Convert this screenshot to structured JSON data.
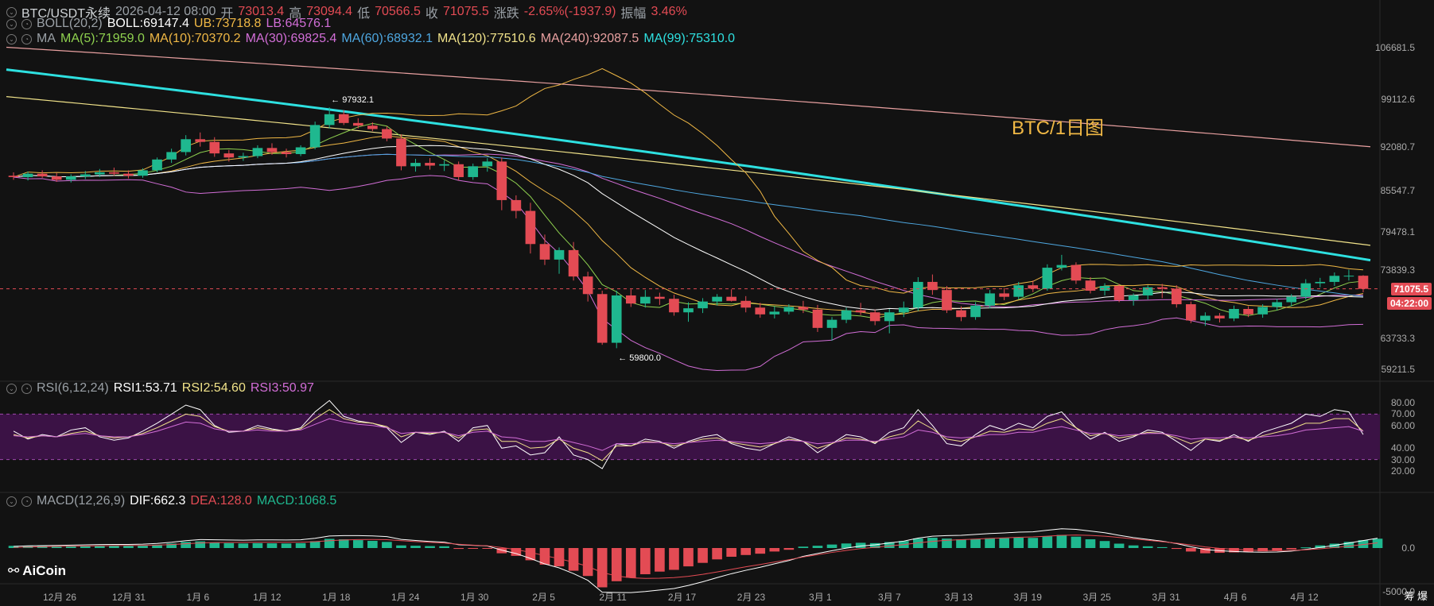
{
  "header": {
    "symbol": "BTC/USDT永续",
    "datetime": "2026-04-12 08:00",
    "open_label": "开",
    "open": "73013.4",
    "high_label": "高",
    "high": "73094.4",
    "low_label": "低",
    "low": "70566.5",
    "close_label": "收",
    "close": "71075.5",
    "change_label": "涨跌",
    "change": "-2.65%(-1937.9)",
    "amp_label": "振幅",
    "amp": "3.46%"
  },
  "boll": {
    "name": "BOLL(20,2)",
    "boll": "BOLL:69147.4",
    "ub": "UB:73718.8",
    "lb": "LB:64576.1"
  },
  "ma": {
    "name": "MA",
    "items": [
      {
        "text": "MA(5):71959.0",
        "color": "#8fd14f"
      },
      {
        "text": "MA(10):70370.2",
        "color": "#f0b845"
      },
      {
        "text": "MA(30):69825.4",
        "color": "#d26ed7"
      },
      {
        "text": "MA(60):68932.1",
        "color": "#4ea7e0"
      },
      {
        "text": "MA(120):77510.6",
        "color": "#f1e38a"
      },
      {
        "text": "MA(240):92087.5",
        "color": "#e8a0a0"
      },
      {
        "text": "MA(99):75310.0",
        "color": "#2ee0e0"
      }
    ]
  },
  "rsi": {
    "name": "RSI(6,12,24)",
    "rsi1": "RSI1:53.71",
    "rsi2": "RSI2:54.60",
    "rsi3": "RSI3:50.97"
  },
  "macd": {
    "name": "MACD(12,26,9)",
    "dif": "DIF:662.3",
    "dea": "DEA:128.0",
    "macd": "MACD:1068.5"
  },
  "watermark": "BTC/1日图",
  "annotations": {
    "high_mark": "← 97932.1",
    "low_mark": "← 59800.0"
  },
  "price_tag": "71075.5",
  "countdown_tag": "04:22:00",
  "logo": "AiCoin",
  "side_text": "筹 爆",
  "chart_data": {
    "type": "candlestick",
    "price_axis_ticks": [
      "106681.5",
      "99112.6",
      "92080.7",
      "85547.7",
      "79478.1",
      "73839.3",
      "63733.3",
      "59211.5"
    ],
    "rsi_axis_ticks": [
      "80.00",
      "70.00",
      "60.00",
      "40.00",
      "30.00",
      "20.00"
    ],
    "macd_axis_ticks": [
      "0.0",
      "-5000.0"
    ],
    "x_ticks": [
      "12月 26",
      "12月 31",
      "1月 6",
      "1月 12",
      "1月 18",
      "1月 24",
      "1月 30",
      "2月 5",
      "2月 11",
      "2月 17",
      "2月 23",
      "3月 1",
      "3月 7",
      "3月 13",
      "3月 19",
      "3月 25",
      "3月 31",
      "4月 6",
      "4月 12"
    ],
    "ylim": [
      58000,
      108500
    ],
    "rsi_bands": [
      30,
      70
    ],
    "colors": {
      "up": "#1fb88f",
      "down": "#e34b54"
    },
    "candles": [
      [
        87800,
        88300,
        87200,
        87600
      ],
      [
        87600,
        88400,
        87100,
        88100
      ],
      [
        88100,
        88600,
        87500,
        87700
      ],
      [
        87700,
        88200,
        86900,
        87200
      ],
      [
        87200,
        88000,
        86800,
        87700
      ],
      [
        87700,
        88500,
        87300,
        88000
      ],
      [
        88000,
        88800,
        87600,
        88300
      ],
      [
        88300,
        89000,
        87800,
        88100
      ],
      [
        88100,
        88600,
        87400,
        87800
      ],
      [
        87800,
        88900,
        87500,
        88600
      ],
      [
        88600,
        90500,
        88300,
        90200
      ],
      [
        90200,
        91800,
        89700,
        91300
      ],
      [
        91300,
        93800,
        90800,
        93200
      ],
      [
        93200,
        94200,
        92100,
        92800
      ],
      [
        92800,
        93500,
        90600,
        91100
      ],
      [
        91100,
        91600,
        89900,
        90500
      ],
      [
        90500,
        91200,
        90000,
        90700
      ],
      [
        90700,
        92300,
        90400,
        91900
      ],
      [
        91900,
        92600,
        90900,
        91300
      ],
      [
        91300,
        91800,
        90500,
        91000
      ],
      [
        91000,
        92300,
        90700,
        92000
      ],
      [
        92000,
        95800,
        91700,
        95300
      ],
      [
        95300,
        97900,
        94800,
        96900
      ],
      [
        96900,
        97500,
        95300,
        95600
      ],
      [
        95600,
        96300,
        94800,
        95200
      ],
      [
        95200,
        95700,
        94400,
        94700
      ],
      [
        94700,
        95100,
        92900,
        93300
      ],
      [
        93300,
        93900,
        88600,
        89200
      ],
      [
        89200,
        90300,
        88400,
        89700
      ],
      [
        89700,
        90400,
        88700,
        89300
      ],
      [
        89300,
        90100,
        88500,
        89500
      ],
      [
        89500,
        89900,
        87100,
        87600
      ],
      [
        87600,
        89600,
        87200,
        89200
      ],
      [
        89200,
        90400,
        88400,
        89900
      ],
      [
        89900,
        90500,
        82700,
        84200
      ],
      [
        84200,
        84900,
        81500,
        82600
      ],
      [
        82600,
        83800,
        76300,
        77700
      ],
      [
        77700,
        79100,
        74600,
        75400
      ],
      [
        75400,
        77200,
        73300,
        76800
      ],
      [
        76800,
        78000,
        72300,
        72900
      ],
      [
        72900,
        73600,
        69200,
        70300
      ],
      [
        70300,
        70800,
        62800,
        63100
      ],
      [
        63100,
        70800,
        62300,
        70100
      ],
      [
        70100,
        71000,
        68400,
        68900
      ],
      [
        68900,
        70900,
        68300,
        69900
      ],
      [
        69900,
        70500,
        68700,
        69600
      ],
      [
        69600,
        70200,
        67100,
        67600
      ],
      [
        67600,
        69100,
        66200,
        68200
      ],
      [
        68200,
        69700,
        67500,
        69200
      ],
      [
        69200,
        70300,
        68600,
        69900
      ],
      [
        69900,
        71000,
        69200,
        69300
      ],
      [
        69300,
        70000,
        67600,
        68300
      ],
      [
        68300,
        69000,
        66800,
        67300
      ],
      [
        67300,
        68500,
        66700,
        67700
      ],
      [
        67700,
        68800,
        67300,
        68400
      ],
      [
        68400,
        69300,
        67500,
        68000
      ],
      [
        68000,
        68700,
        64700,
        65300
      ],
      [
        65300,
        66900,
        63400,
        66500
      ],
      [
        66500,
        68300,
        66000,
        67900
      ],
      [
        67900,
        69000,
        67200,
        67600
      ],
      [
        67600,
        68000,
        65700,
        66300
      ],
      [
        66300,
        68100,
        64500,
        67600
      ],
      [
        67600,
        69200,
        66900,
        68300
      ],
      [
        68300,
        72800,
        67800,
        72100
      ],
      [
        72100,
        73200,
        70200,
        70900
      ],
      [
        70900,
        71500,
        67500,
        67900
      ],
      [
        67900,
        68500,
        66300,
        66900
      ],
      [
        66900,
        69100,
        66500,
        68600
      ],
      [
        68600,
        70900,
        68200,
        70400
      ],
      [
        70400,
        71200,
        69400,
        69900
      ],
      [
        69900,
        72100,
        69500,
        71600
      ],
      [
        71600,
        72300,
        70600,
        71100
      ],
      [
        71100,
        74700,
        70800,
        74200
      ],
      [
        74200,
        76100,
        73800,
        74600
      ],
      [
        74600,
        75000,
        71800,
        72300
      ],
      [
        72300,
        72800,
        70400,
        70800
      ],
      [
        70800,
        71900,
        70100,
        71500
      ],
      [
        71500,
        71800,
        69100,
        69400
      ],
      [
        69400,
        70400,
        68600,
        70100
      ],
      [
        70100,
        71600,
        69500,
        71300
      ],
      [
        71300,
        71800,
        69700,
        71100
      ],
      [
        71100,
        71600,
        68300,
        68800
      ],
      [
        68800,
        69200,
        66000,
        66400
      ],
      [
        66400,
        67600,
        65600,
        67100
      ],
      [
        67100,
        67500,
        66100,
        66700
      ],
      [
        66700,
        68600,
        66300,
        68100
      ],
      [
        68100,
        68500,
        66900,
        67300
      ],
      [
        67300,
        68800,
        66800,
        68400
      ],
      [
        68400,
        69600,
        67900,
        69100
      ],
      [
        69100,
        70300,
        68500,
        69900
      ],
      [
        69900,
        72500,
        69500,
        71900
      ],
      [
        71900,
        72700,
        71300,
        72100
      ],
      [
        72100,
        73500,
        71500,
        73000
      ],
      [
        73000,
        73900,
        72300,
        73013
      ],
      [
        73013,
        73094,
        70566,
        71075
      ]
    ],
    "lines": {
      "ma99": {
        "color": "#2ee0e0",
        "from": 103500,
        "to": 75310
      },
      "ma240": {
        "color": "#e8a0a0",
        "from": 106800,
        "to": 92087
      },
      "ma120": {
        "color": "#f1e38a",
        "from": 99500,
        "to": 77510
      }
    },
    "rsi_series": {
      "rsi1": [
        55,
        48,
        52,
        50,
        56,
        58,
        50,
        47,
        49,
        55,
        62,
        70,
        78,
        74,
        60,
        54,
        55,
        60,
        57,
        55,
        58,
        72,
        82,
        68,
        64,
        62,
        58,
        45,
        54,
        52,
        55,
        46,
        58,
        60,
        40,
        42,
        34,
        36,
        50,
        34,
        30,
        22,
        44,
        42,
        48,
        46,
        40,
        46,
        50,
        52,
        44,
        40,
        38,
        44,
        50,
        46,
        36,
        44,
        52,
        50,
        44,
        54,
        58,
        74,
        60,
        44,
        42,
        52,
        60,
        56,
        62,
        58,
        68,
        72,
        58,
        48,
        54,
        46,
        50,
        56,
        54,
        46,
        38,
        48,
        46,
        52,
        46,
        54,
        58,
        62,
        70,
        68,
        74,
        72,
        52
      ],
      "rsi2": [
        52,
        49,
        51,
        50,
        53,
        55,
        51,
        49,
        50,
        53,
        58,
        64,
        70,
        68,
        59,
        55,
        55,
        58,
        56,
        55,
        57,
        66,
        74,
        66,
        63,
        62,
        59,
        50,
        54,
        53,
        54,
        49,
        56,
        57,
        46,
        46,
        40,
        41,
        48,
        40,
        36,
        29,
        42,
        42,
        46,
        45,
        42,
        45,
        48,
        49,
        45,
        43,
        41,
        44,
        48,
        46,
        40,
        44,
        49,
        48,
        45,
        50,
        53,
        64,
        57,
        48,
        46,
        50,
        55,
        54,
        57,
        56,
        62,
        66,
        58,
        51,
        53,
        49,
        51,
        54,
        53,
        49,
        44,
        48,
        47,
        50,
        47,
        51,
        54,
        57,
        62,
        62,
        66,
        66,
        55
      ],
      "rsi3": [
        51,
        50,
        51,
        50,
        52,
        53,
        51,
        50,
        50,
        52,
        55,
        59,
        63,
        62,
        57,
        55,
        55,
        56,
        55,
        55,
        56,
        61,
        66,
        63,
        61,
        60,
        58,
        53,
        54,
        54,
        54,
        51,
        54,
        55,
        50,
        49,
        46,
        46,
        48,
        45,
        42,
        38,
        44,
        44,
        45,
        45,
        44,
        45,
        46,
        47,
        46,
        45,
        44,
        45,
        47,
        46,
        44,
        45,
        47,
        47,
        46,
        48,
        50,
        56,
        54,
        50,
        49,
        50,
        52,
        52,
        54,
        54,
        57,
        59,
        56,
        53,
        53,
        51,
        52,
        53,
        53,
        51,
        48,
        49,
        49,
        50,
        49,
        50,
        51,
        53,
        56,
        57,
        58,
        59,
        55
      ]
    },
    "macd_hist": [
      250,
      260,
      240,
      230,
      250,
      260,
      280,
      270,
      260,
      290,
      380,
      520,
      700,
      760,
      640,
      560,
      520,
      560,
      540,
      520,
      560,
      780,
      1050,
      1000,
      900,
      820,
      700,
      300,
      260,
      220,
      200,
      -100,
      -40,
      -40,
      -600,
      -900,
      -1400,
      -1900,
      -2100,
      -2600,
      -3200,
      -4500,
      -3800,
      -3400,
      -3000,
      -2700,
      -2500,
      -2100,
      -1700,
      -1300,
      -1000,
      -800,
      -650,
      -400,
      -200,
      160,
      260,
      400,
      520,
      600,
      560,
      680,
      800,
      1100,
      1180,
      1080,
      1000,
      1050,
      1120,
      1130,
      1180,
      1160,
      1350,
      1500,
      1300,
      1000,
      800,
      500,
      300,
      200,
      100,
      -100,
      -400,
      -600,
      -550,
      -500,
      -450,
      -380,
      -300,
      -150,
      80,
      300,
      500,
      700,
      900,
      1068
    ]
  }
}
